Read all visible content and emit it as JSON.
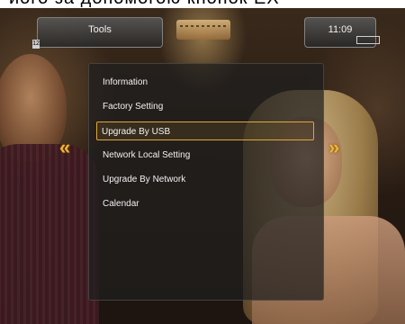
{
  "overlay_text": "його за допомогою кнопок  EX",
  "header": {
    "title": "Tools",
    "clock": "11:09"
  },
  "badges": {
    "left": "12"
  },
  "menu": {
    "items": [
      {
        "label": "Information",
        "selected": false
      },
      {
        "label": "Factory Setting",
        "selected": false
      },
      {
        "label": "Upgrade By USB",
        "selected": true
      },
      {
        "label": "Network Local Setting",
        "selected": false
      },
      {
        "label": "Upgrade By Network",
        "selected": false
      },
      {
        "label": "Calendar",
        "selected": false
      }
    ]
  },
  "navigation": {
    "left_arrow": "«",
    "right_arrow": "»"
  },
  "colors": {
    "highlight": "#e3a53a",
    "arrow": "#f3b233"
  }
}
